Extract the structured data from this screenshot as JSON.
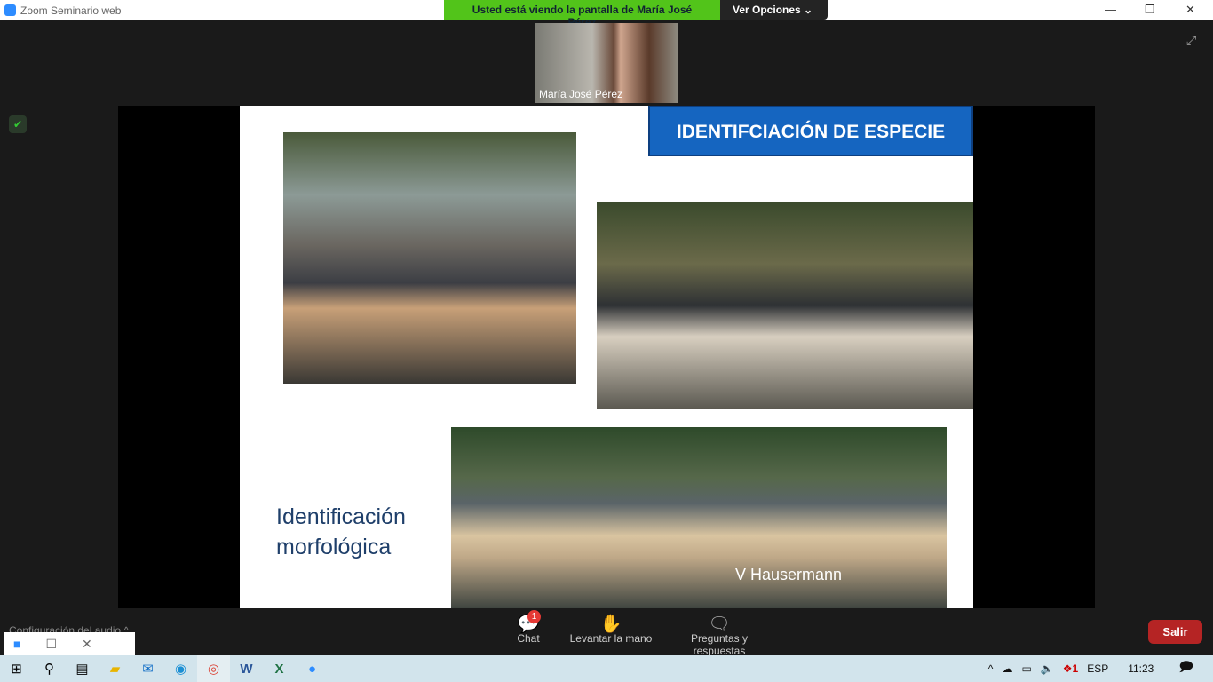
{
  "window": {
    "title": "Zoom Seminario web",
    "minimize": "—",
    "restore": "❐",
    "close": "✕"
  },
  "share_banner": {
    "text": "Usted está viendo la pantalla de María José Pérez",
    "options": "Ver Opciones ⌄"
  },
  "video": {
    "name": "María José Pérez"
  },
  "slide": {
    "title": "IDENTIFCIACIÓN DE ESPECIE",
    "caption_line1": "Identificación",
    "caption_line2": "morfológica",
    "photo_credit": "V Hausermann"
  },
  "controls": {
    "chat": "Chat",
    "chat_badge": "1",
    "raise_hand": "Levantar la mano",
    "qa": "Preguntas y respuestas",
    "leave": "Salir",
    "audio_settings": "Configuración del audio ^"
  },
  "taskbar": {
    "language": "ESP",
    "time": "11:23",
    "notification_badge": "1"
  },
  "colors": {
    "banner_green": "#52c41a",
    "title_blue": "#1565c0",
    "leave_red": "#b52424",
    "zoom_blue": "#2d8cff"
  }
}
